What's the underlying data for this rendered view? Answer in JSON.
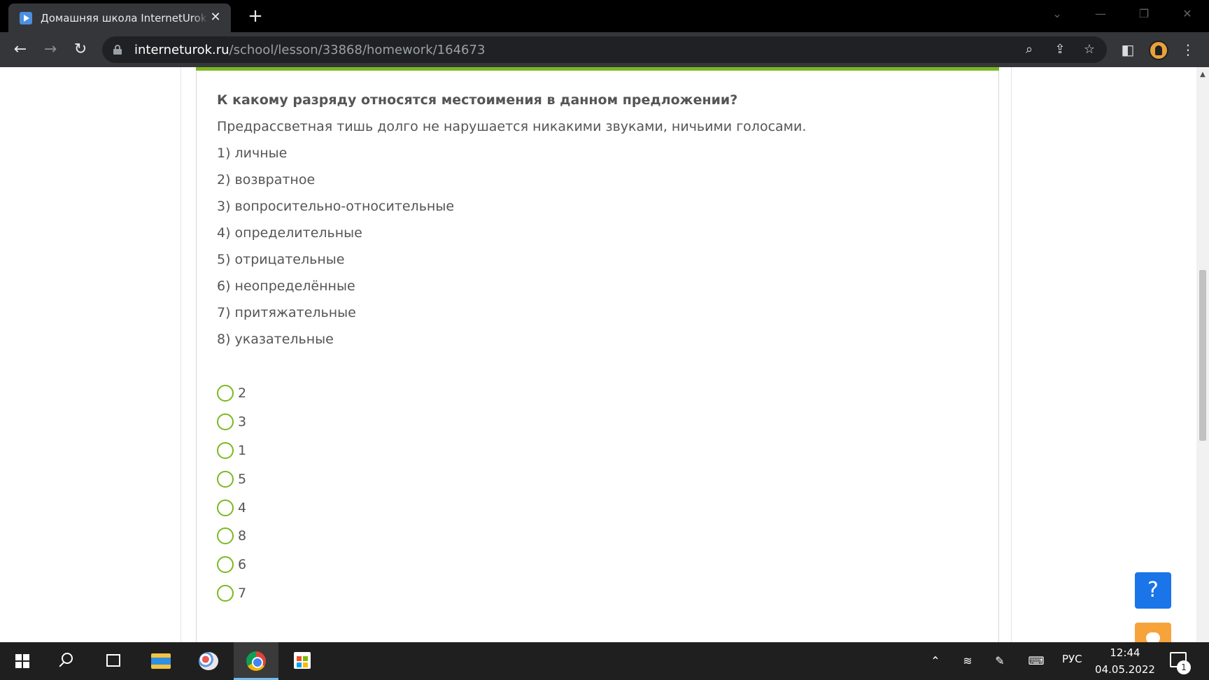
{
  "browser": {
    "tab_title": "Домашняя школа InternetUrok.ru",
    "tab_close": "✕",
    "new_tab": "+",
    "url_host": "interneturok.ru",
    "url_path": "/school/lesson/33868/homework/164673",
    "icons": [
      "back-arrow-icon",
      "forward-arrow-icon",
      "reload-icon",
      "lock-icon",
      "zoom-icon",
      "share-icon",
      "star-icon",
      "side-panel-icon",
      "profile-avatar",
      "menu-dots-icon"
    ]
  },
  "lesson": {
    "question": "К какому разряду относятся местоимения в данном предложении?",
    "sentence": "Предрассветная тишь долго не нарушается никакими звуками, ничьими голосами.",
    "options": [
      "1) личные",
      "2) возвратное",
      "3) вопросительно-относительные",
      "4) определительные",
      "5) отрицательные",
      "6) неопределённые",
      "7) притяжательные",
      "8) указательные"
    ],
    "answers": [
      "2",
      "3",
      "1",
      "5",
      "4",
      "8",
      "6",
      "7"
    ],
    "accent_color": "#7cb822"
  },
  "widgets": {
    "help_label": "?",
    "help_color": "#1a75e8",
    "chat_color": "#f7a33c"
  },
  "taskbar": {
    "language": "РУС",
    "time": "12:44",
    "date": "04.05.2022",
    "notification_count": "1"
  }
}
